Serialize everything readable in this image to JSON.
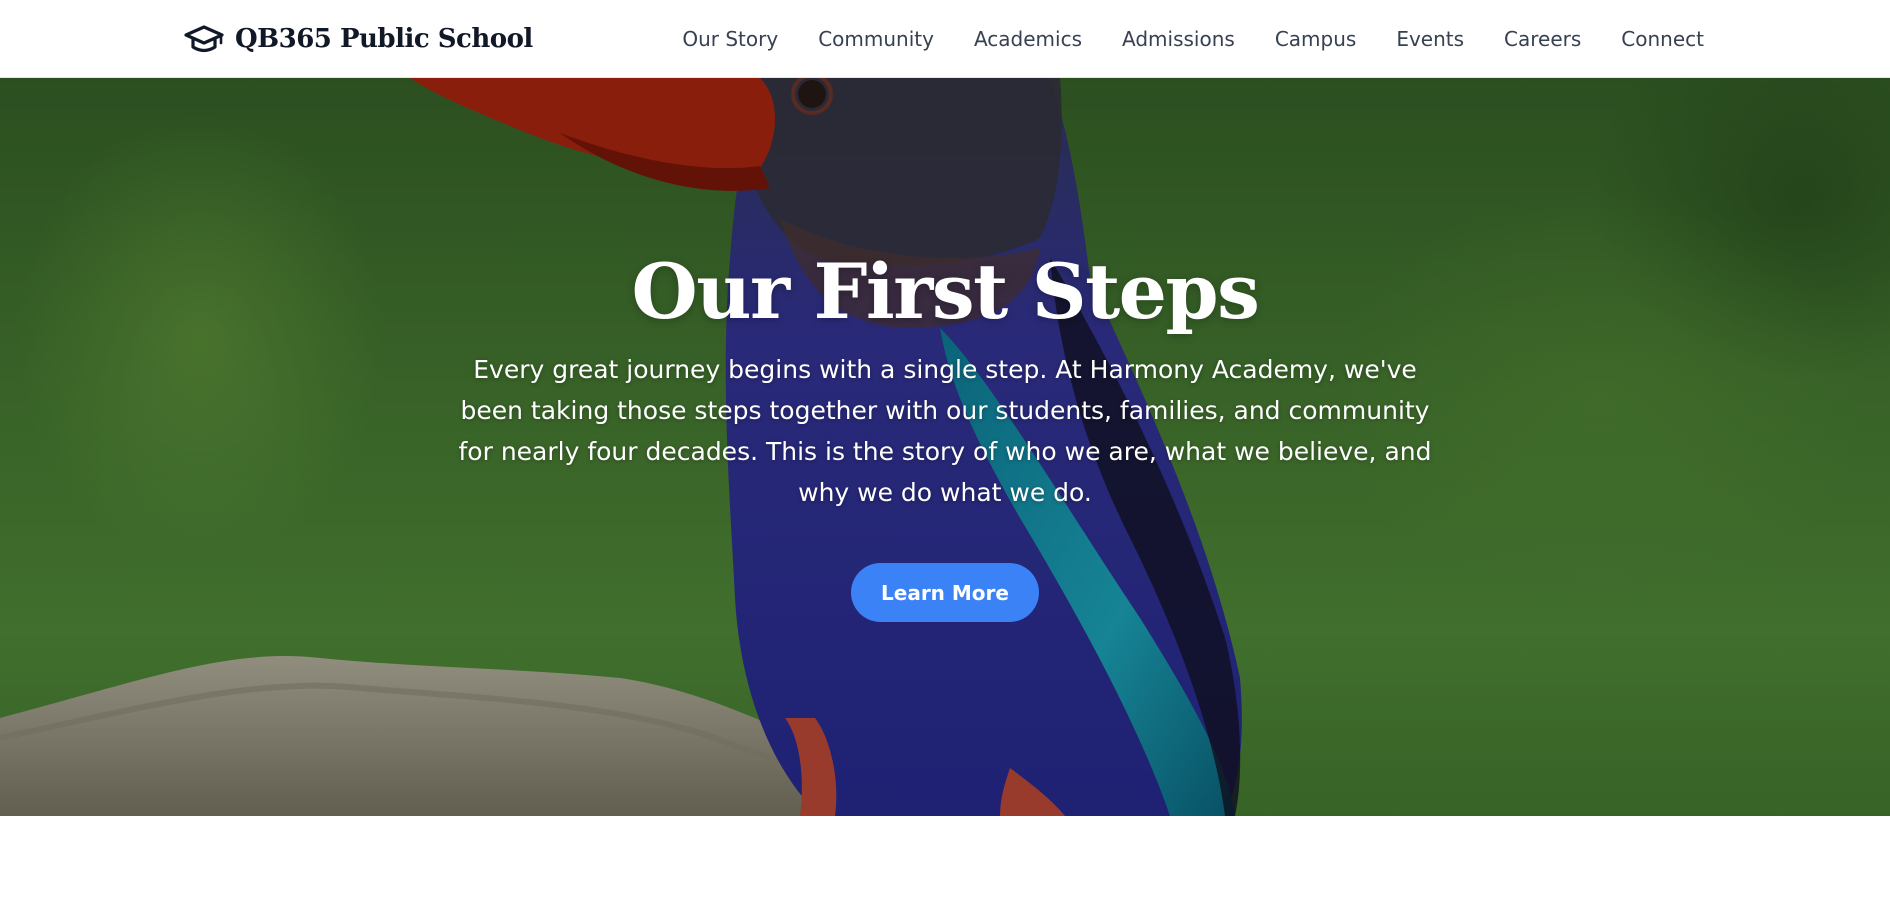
{
  "brand": {
    "name": "QB365 Public School",
    "icon": "graduation-cap-icon"
  },
  "nav": {
    "items": [
      "Our Story",
      "Community",
      "Academics",
      "Admissions",
      "Campus",
      "Events",
      "Careers",
      "Connect"
    ]
  },
  "hero": {
    "title": "Our First Steps",
    "text": "Every great journey begins with a single step. At Harmony Academy, we've been taking those steps together with our students, families, and community for nearly four decades. This is the story of who we are, what we believe, and why we do what we do.",
    "button_label": "Learn More",
    "background_image": "kingfisher bird perched on branch",
    "colors": {
      "button": "#3b82f6",
      "title": "#ffffff"
    }
  }
}
